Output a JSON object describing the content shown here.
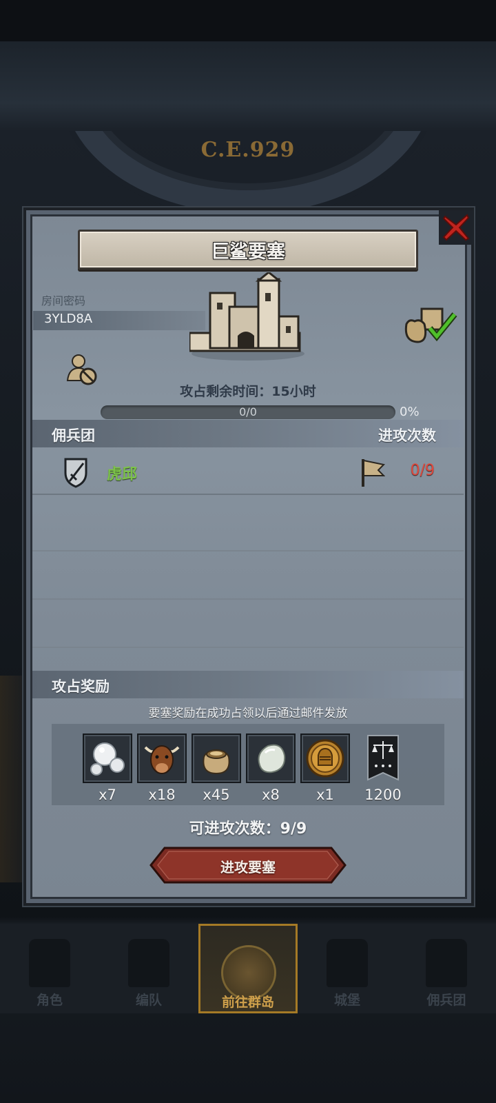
{
  "background": {
    "year": "C.E.929"
  },
  "dialog": {
    "title": "巨鲨要塞",
    "room_label": "房间密码",
    "room_code": "3YLD8A",
    "timer_text": "攻占剩余时间：15小时",
    "progress_text": "0/0",
    "progress_percent": "0%",
    "progress_value": 0,
    "mercenary_section": {
      "label": "佣兵团",
      "attack_count_label": "进攻次数"
    },
    "mercenaries": [
      {
        "name": "虎邱",
        "attacks": "0/9"
      }
    ],
    "reward_section": {
      "label": "攻占奖励"
    },
    "reward_note": "要塞奖励在成功占领以后通过邮件发放",
    "rewards": [
      {
        "icon": "pearl-icon",
        "qty": "x7"
      },
      {
        "icon": "ox-icon",
        "qty": "x18"
      },
      {
        "icon": "sack-icon",
        "qty": "x45"
      },
      {
        "icon": "stone-icon",
        "qty": "x8"
      },
      {
        "icon": "knight-coin-icon",
        "qty": "x1"
      },
      {
        "icon": "justice-banner-icon",
        "qty": "1200"
      }
    ],
    "attempts_text": "可进攻次数：9/9",
    "attack_button": "进攻要塞"
  },
  "bottom_nav": [
    {
      "label": "角色",
      "active": false
    },
    {
      "label": "编队",
      "active": false
    },
    {
      "label": "前往群岛",
      "active": true
    },
    {
      "label": "城堡",
      "active": false
    },
    {
      "label": "佣兵团",
      "active": false
    }
  ],
  "colors": {
    "panel": "#8894a0",
    "mercenary_name": "#7cc24a",
    "attack_count": "#e04a3e",
    "attack_button": "#8a2c22",
    "nav_active": "#cfa04b"
  }
}
